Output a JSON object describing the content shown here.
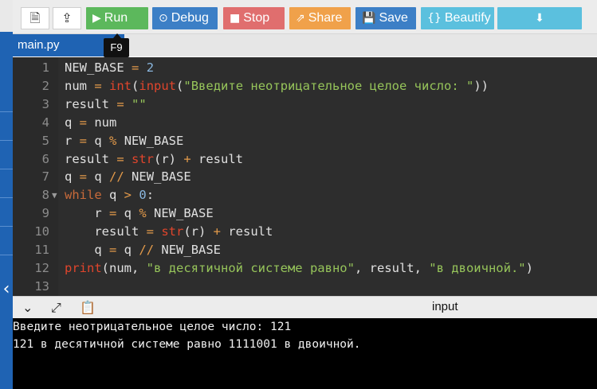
{
  "toolbar": {
    "buttons": [
      {
        "label": "Run",
        "icon": "play-icon",
        "color": "#5cb85c"
      },
      {
        "label": "Debug",
        "icon": "debug-icon",
        "color": "#3c7fc6"
      },
      {
        "label": "Stop",
        "icon": "stop-icon",
        "color": "#e06e6e"
      },
      {
        "label": "Share",
        "icon": "share-icon",
        "color": "#f0a14a"
      },
      {
        "label": "Save",
        "icon": "save-icon",
        "color": "#3c7fc6"
      },
      {
        "label": "Beautify",
        "icon": "braces-icon",
        "color": "#5bc0de"
      }
    ]
  },
  "tab": {
    "filename": "main.py",
    "tooltip": "F9"
  },
  "editor": {
    "line_numbers": [
      "1",
      "2",
      "3",
      "4",
      "5",
      "6",
      "7",
      "8",
      "9",
      "10",
      "11",
      "12",
      "13"
    ],
    "lines": [
      "NEW_BASE = 2",
      "num = int(input(\"Введите неотрицательное целое число: \"))",
      "result = \"\"",
      "q = num",
      "r = q % NEW_BASE",
      "result = str(r) + result",
      "q = q // NEW_BASE",
      "while q > 0:",
      "    r = q % NEW_BASE",
      "    result = str(r) + result",
      "    q = q // NEW_BASE",
      "print(num, \"в десятичной системе равно\", result, \"в двоичной.\")",
      ""
    ]
  },
  "output": {
    "header_label": "input",
    "lines": [
      "Введите неотрицательное целое число: 121",
      "121 в десятичной системе равно 1111001 в двоичной."
    ]
  }
}
